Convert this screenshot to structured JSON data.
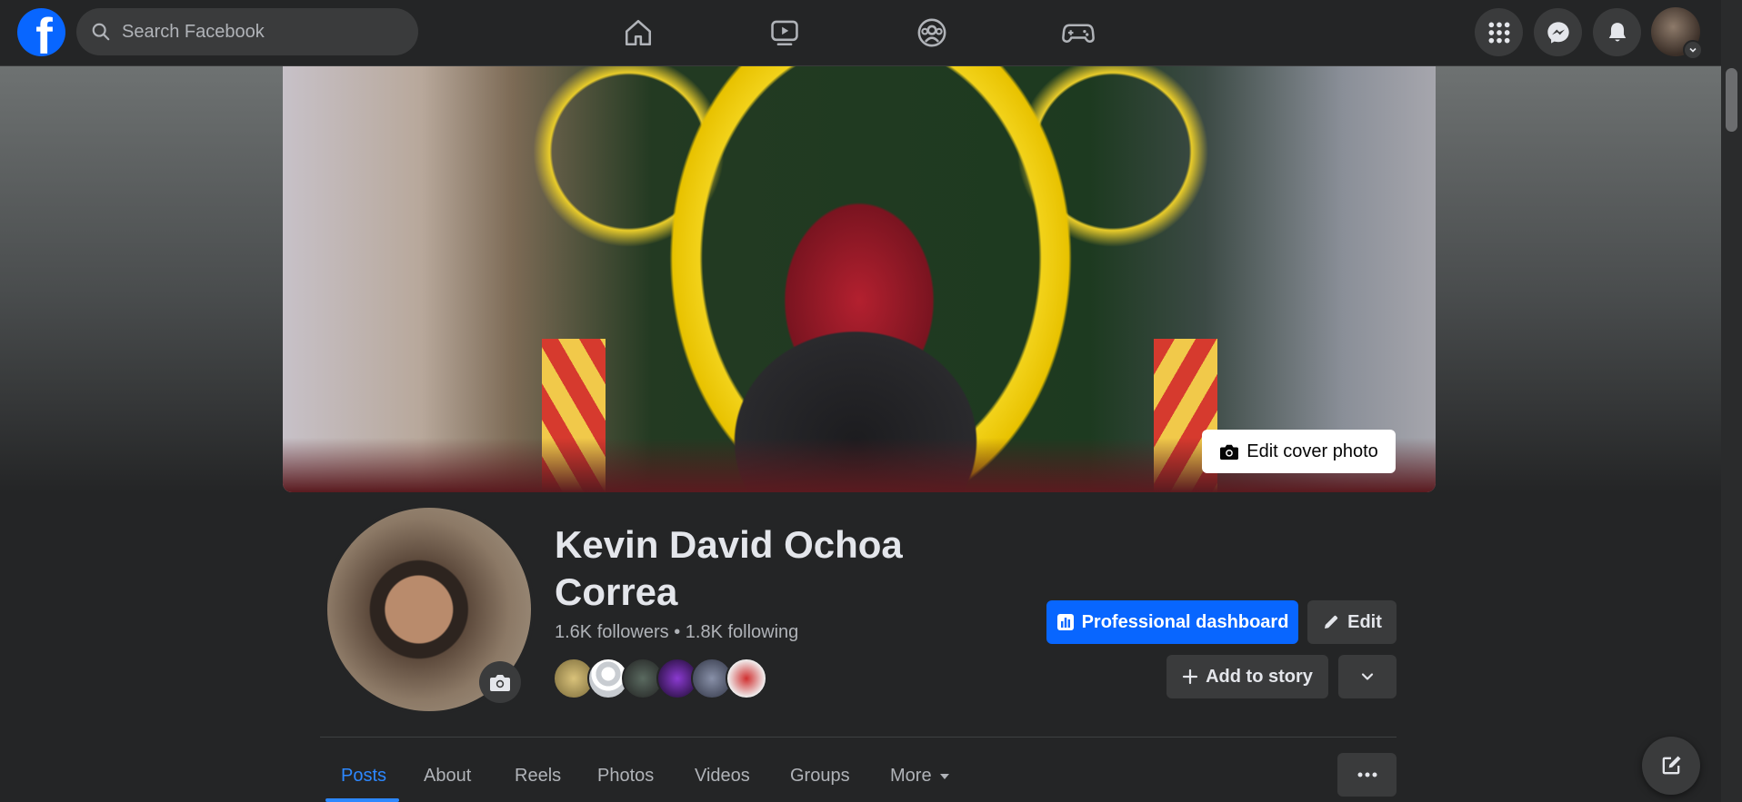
{
  "topbar": {
    "logo_letter": "f",
    "search_placeholder": "Search Facebook",
    "nav_icons": [
      "home-icon",
      "watch-icon",
      "groups-icon",
      "gaming-icon"
    ],
    "right_icons": [
      "menu-grid-icon",
      "messenger-icon",
      "notifications-icon"
    ]
  },
  "cover": {
    "edit_label": "Edit cover photo"
  },
  "profile": {
    "name_line1": "Kevin David Ochoa",
    "name_line2": "Correa",
    "followers": "1.6K followers",
    "separator": "•",
    "following": "1.8K following",
    "friend_avatars_count": 6
  },
  "actions": {
    "professional_dashboard": "Professional dashboard",
    "edit": "Edit",
    "add_to_story": "Add to story"
  },
  "tabs": [
    {
      "label": "Posts",
      "active": true
    },
    {
      "label": "About"
    },
    {
      "label": "Reels"
    },
    {
      "label": "Photos"
    },
    {
      "label": "Videos"
    },
    {
      "label": "Groups"
    },
    {
      "label": "More"
    }
  ],
  "colors": {
    "accent": "#0866ff",
    "active_tab": "#2d88ff",
    "surface": "#242526",
    "button": "#3a3b3c"
  }
}
